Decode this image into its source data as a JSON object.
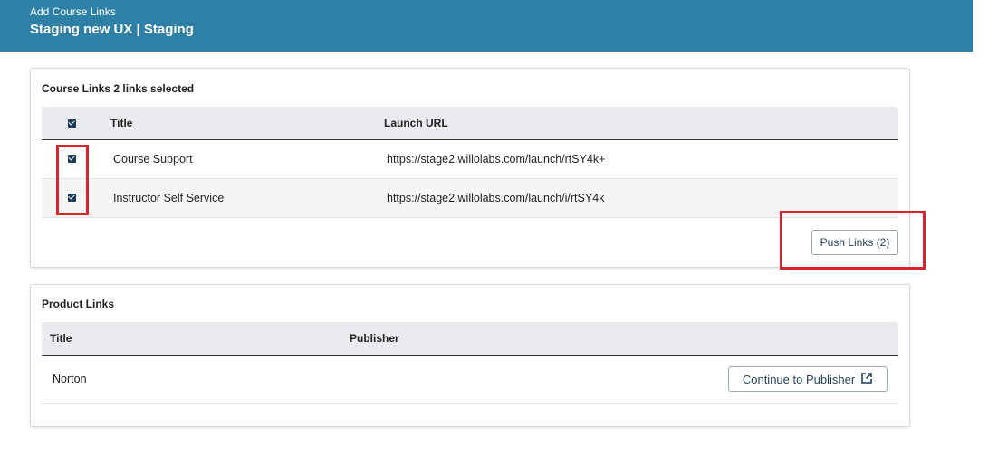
{
  "header": {
    "subtitle": "Add Course Links",
    "title": "Staging new UX | Staging"
  },
  "course_links": {
    "title": "Course Links 2 links selected",
    "columns": {
      "title": "Title",
      "launch_url": "Launch URL"
    },
    "rows": [
      {
        "title": "Course Support",
        "launch_url": "https://stage2.willolabs.com/launch/rtSY4k+",
        "checked": true
      },
      {
        "title": "Instructor Self Service",
        "launch_url": "https://stage2.willolabs.com/launch/i/rtSY4k",
        "checked": true
      }
    ],
    "push_button": "Push Links (2)"
  },
  "product_links": {
    "title": "Product Links",
    "columns": {
      "title": "Title",
      "publisher": "Publisher"
    },
    "rows": [
      {
        "title": "Norton",
        "action": "Continue to Publisher"
      }
    ]
  },
  "colors": {
    "header_bg": "#2f80a6",
    "highlight": "#d9232d",
    "checkbox": "#1b3a57"
  }
}
